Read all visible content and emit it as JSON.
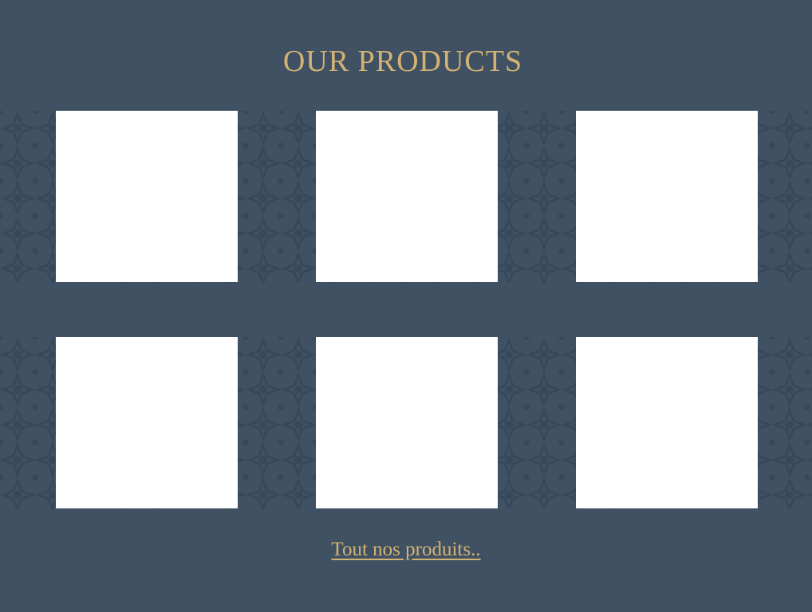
{
  "section": {
    "title": "OUR PRODUCTS",
    "link_label": "Tout nos produits.."
  },
  "products": [
    {
      "slot": 1
    },
    {
      "slot": 2
    },
    {
      "slot": 3
    },
    {
      "slot": 4
    },
    {
      "slot": 5
    },
    {
      "slot": 6
    }
  ],
  "colors": {
    "background": "#3f5163",
    "accent_gold": "#d4b273",
    "pattern": "#37485a",
    "card": "#ffffff"
  }
}
